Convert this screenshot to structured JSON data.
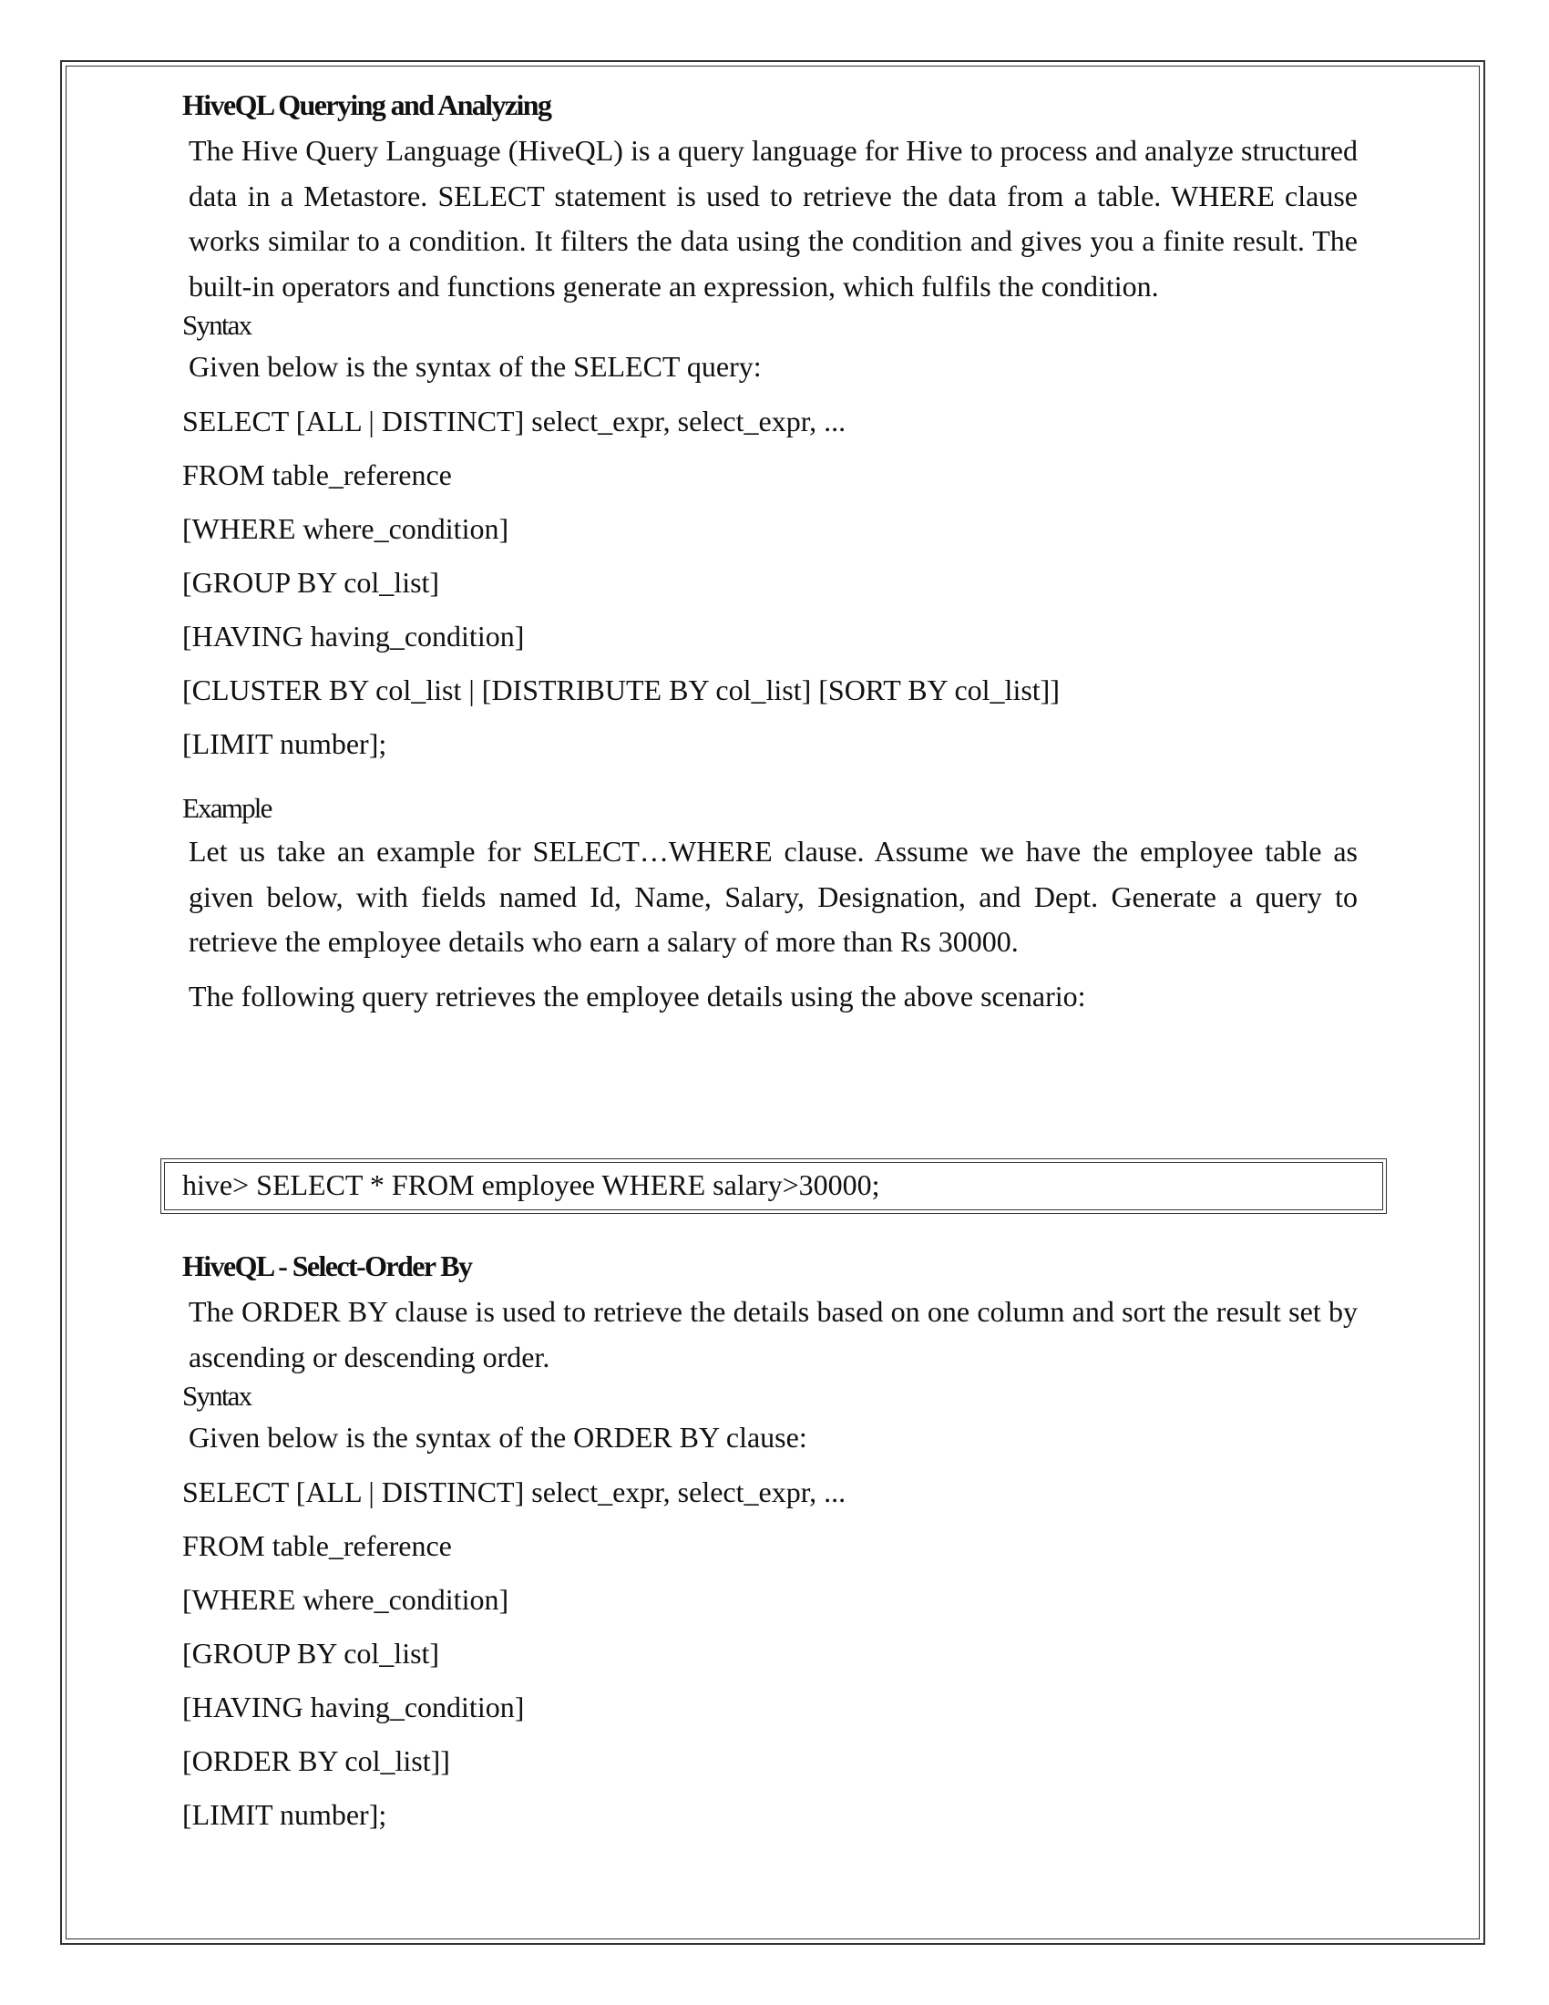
{
  "section1": {
    "heading": "HiveQL Querying and Analyzing",
    "intro": "The Hive Query Language (HiveQL) is a query language for Hive to process and analyze structured data in a Metastore. SELECT statement is used to retrieve the data from a table. WHERE clause works similar to a condition. It filters the data using the condition and gives you a finite result. The built-in operators and functions generate an expression, which fulfils the condition.",
    "syntax_label": "Syntax",
    "syntax_intro": "Given below is the syntax of the SELECT query:",
    "syntax_lines": [
      "SELECT [ALL | DISTINCT] select_expr, select_expr, ...",
      "FROM table_reference",
      "[WHERE where_condition]",
      "[GROUP BY col_list]",
      "[HAVING having_condition]",
      "[CLUSTER BY col_list | [DISTRIBUTE BY col_list] [SORT BY col_list]]",
      "[LIMIT number];"
    ],
    "example_label": "Example",
    "example_text": "Let us take an example for SELECT…WHERE clause. Assume we have the employee table as given below, with fields named Id, Name, Salary, Designation, and Dept. Generate a query to retrieve the employee details who earn a salary of more than Rs 30000.",
    "query_intro": "The following query retrieves the employee details using the above scenario:",
    "query_code": "hive> SELECT * FROM employee WHERE salary>30000;"
  },
  "section2": {
    "heading": "HiveQL - Select-Order By",
    "intro": "The ORDER BY clause is used to retrieve the details based on one column and sort the result set by ascending or descending order.",
    "syntax_label": "Syntax",
    "syntax_intro": "Given below is the syntax of the ORDER BY clause:",
    "syntax_lines": [
      "SELECT [ALL | DISTINCT] select_expr, select_expr, ...",
      "FROM table_reference",
      "[WHERE where_condition]",
      "[GROUP BY col_list]",
      "[HAVING having_condition]",
      "[ORDER BY col_list]]",
      "[LIMIT number];"
    ]
  }
}
